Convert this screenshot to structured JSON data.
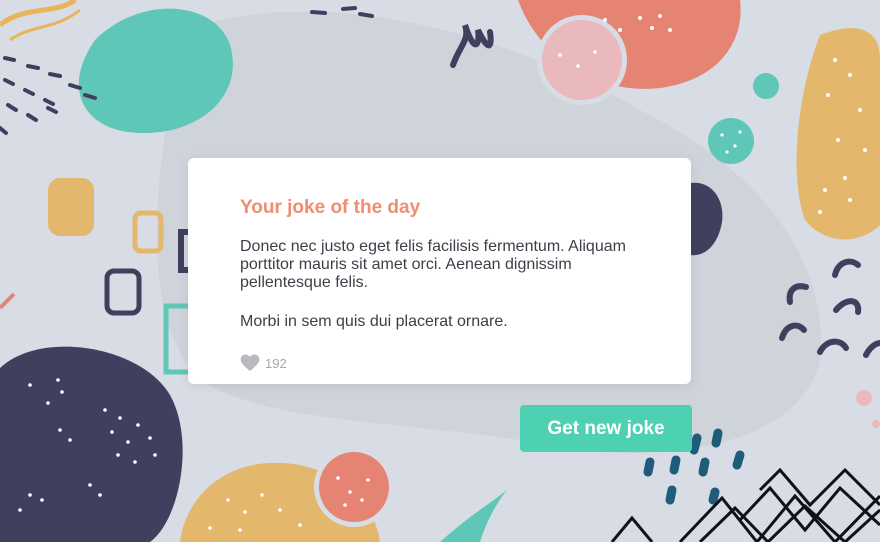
{
  "card": {
    "title": "Your joke of the day",
    "paragraphs": [
      "Donec nec justo eget felis facilisis fermentum. Aliquam porttitor mauris sit amet orci. Aenean dignissim pellentesque felis.",
      "Morbi in sem quis dui placerat ornare."
    ],
    "likes": {
      "icon": "heart-icon",
      "count": "192"
    }
  },
  "button": {
    "label": "Get new joke"
  },
  "colors": {
    "background": "#d8dde5",
    "title": "#f08d72",
    "button": "#4dd1b2",
    "navy": "#3f3f5e",
    "teal": "#5fc7b7",
    "coral": "#e58473",
    "mustard": "#e3b76c",
    "pink": "#e9b9bd"
  }
}
